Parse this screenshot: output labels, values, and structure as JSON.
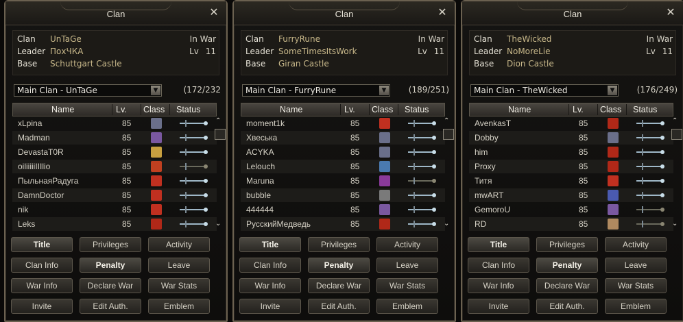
{
  "panels": [
    {
      "title": "Clan",
      "info": {
        "clan_label": "Clan",
        "clan": "UnTaGe",
        "leader_label": "Leader",
        "leader": "ПохЧКА",
        "base_label": "Base",
        "base": "Schuttgart Castle",
        "status": "In War",
        "lv_label": "Lv",
        "lv": "11"
      },
      "dropdown": "Main Clan - UnTaGe",
      "count": "(172/232",
      "columns": [
        "Name",
        "Lv.",
        "Class",
        "Status"
      ],
      "members": [
        {
          "name": "xLpina",
          "lv": "85",
          "color": "#6a6f8a"
        },
        {
          "name": "Madman",
          "lv": "85",
          "color": "#7a58a0"
        },
        {
          "name": "DevastaT0R",
          "lv": "85",
          "color": "#c8a040"
        },
        {
          "name": "oiliiiiiIIIlio",
          "lv": "85",
          "color": "#c04020",
          "dim": true
        },
        {
          "name": "ПыльнаяРадуга",
          "lv": "85",
          "color": "#c03020"
        },
        {
          "name": "DamnDoctor",
          "lv": "85",
          "color": "#c03020"
        },
        {
          "name": "nik",
          "lv": "85",
          "color": "#c03020"
        },
        {
          "name": "Leks",
          "lv": "85",
          "color": "#b02818"
        }
      ],
      "buttons": [
        [
          "Title",
          "Privileges",
          "Activity"
        ],
        [
          "Clan Info",
          "Penalty",
          "Leave"
        ],
        [
          "War Info",
          "Declare War",
          "War Stats"
        ],
        [
          "Invite",
          "Edit Auth.",
          "Emblem"
        ]
      ]
    },
    {
      "title": "Clan",
      "info": {
        "clan_label": "Clan",
        "clan": "FurryRune",
        "leader_label": "Leader",
        "leader": "SomeTimesItsWork",
        "base_label": "Base",
        "base": "Giran Castle",
        "status": "In War",
        "lv_label": "Lv",
        "lv": "11"
      },
      "dropdown": "Main Clan - FurryRune",
      "count": "(189/251)",
      "columns": [
        "Name",
        "Lv.",
        "Class",
        "Status"
      ],
      "members": [
        {
          "name": "moment1k",
          "lv": "85",
          "color": "#c03020"
        },
        {
          "name": "Хвеська",
          "lv": "85",
          "color": "#6a6f8a"
        },
        {
          "name": "ACYKA",
          "lv": "85",
          "color": "#6a6f8a"
        },
        {
          "name": "Lelouch",
          "lv": "85",
          "color": "#4a7ab0"
        },
        {
          "name": "Maruna",
          "lv": "85",
          "color": "#8a3a9a",
          "dim": true
        },
        {
          "name": "bubble",
          "lv": "85",
          "color": "#7a7a7a"
        },
        {
          "name": "444444",
          "lv": "85",
          "color": "#7a58a0"
        },
        {
          "name": "РусскийМедведь",
          "lv": "85",
          "color": "#b02818"
        }
      ],
      "buttons": [
        [
          "Title",
          "Privileges",
          "Activity"
        ],
        [
          "Clan Info",
          "Penalty",
          "Leave"
        ],
        [
          "War Info",
          "Declare War",
          "War Stats"
        ],
        [
          "Invite",
          "Edit Auth.",
          "Emblem"
        ]
      ]
    },
    {
      "title": "Clan",
      "info": {
        "clan_label": "Clan",
        "clan": "TheWicked",
        "leader_label": "Leader",
        "leader": "NoMoreLie",
        "base_label": "Base",
        "base": "Dion Castle",
        "status": "In War",
        "lv_label": "Lv",
        "lv": "11"
      },
      "dropdown": "Main Clan - TheWicked",
      "count": "(176/249)",
      "columns": [
        "Name",
        "Lv.",
        "Class",
        "Status"
      ],
      "members": [
        {
          "name": "AvenkasT",
          "lv": "85",
          "color": "#b02818"
        },
        {
          "name": "Dobby",
          "lv": "85",
          "color": "#6a6f8a"
        },
        {
          "name": "him",
          "lv": "85",
          "color": "#b02818"
        },
        {
          "name": "Proxy",
          "lv": "85",
          "color": "#b02818"
        },
        {
          "name": "Титя",
          "lv": "85",
          "color": "#c03020"
        },
        {
          "name": "mwART",
          "lv": "85",
          "color": "#4a5ab0"
        },
        {
          "name": "GemoroU",
          "lv": "85",
          "color": "#7a58a0",
          "dim": true
        },
        {
          "name": "RD",
          "lv": "85",
          "color": "#b08a60",
          "dim": true
        }
      ],
      "buttons": [
        [
          "Title",
          "Privileges",
          "Activity"
        ],
        [
          "Clan Info",
          "Penalty",
          "Leave"
        ],
        [
          "War Info",
          "Declare War",
          "War Stats"
        ],
        [
          "Invite",
          "Edit Auth.",
          "Emblem"
        ]
      ]
    }
  ],
  "icons": {
    "close": "close-icon",
    "dropdown": "chevron-down-icon",
    "status": "sword-icon"
  }
}
